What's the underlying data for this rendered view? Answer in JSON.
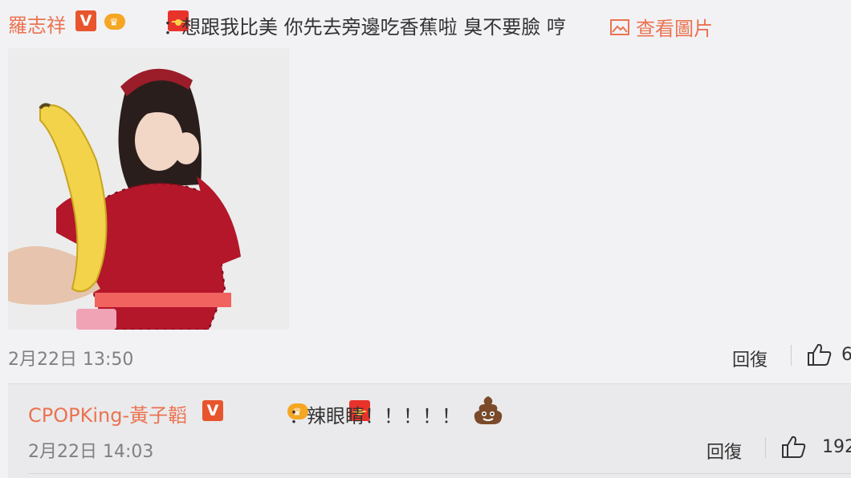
{
  "comment": {
    "username": "羅志祥",
    "badge_letter": "V",
    "separator": "：",
    "text": "想跟我比美 你先去旁邊吃香蕉啦 臭不要臉 哼",
    "view_image_label": "查看圖片",
    "timestamp": "2月22日 13:50",
    "reply_label": "回復",
    "like_count": "6"
  },
  "reply": {
    "username": "CPOPKing-黃子韜",
    "badge_letter": "V",
    "separator": "：",
    "text": "辣眼睛！！！！！",
    "emoji_name": "poop-emoji",
    "timestamp": "2月22日 14:03",
    "reply_label": "回復",
    "like_count": "192"
  },
  "colors": {
    "accent": "#eb7350",
    "badge": "#e8552d",
    "background": "#f2f2f5"
  }
}
